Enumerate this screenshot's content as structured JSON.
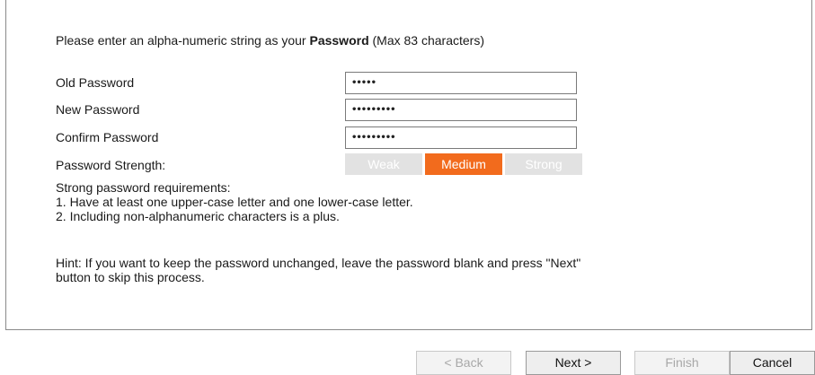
{
  "intro": {
    "prefix": "Please enter an alpha-numeric string as your ",
    "bold": "Password",
    "suffix": " (Max 83 characters)"
  },
  "fields": [
    {
      "label": "Old Password",
      "value": "•••••"
    },
    {
      "label": "New Password",
      "value": "•••••••••"
    },
    {
      "label": "Confirm Password",
      "value": "•••••••••"
    }
  ],
  "strength": {
    "label": "Password Strength:",
    "levels": [
      "Weak",
      "Medium",
      "Strong"
    ],
    "active": "Medium",
    "active_color": "#f26b1d",
    "inactive_color": "#e2e2e2"
  },
  "requirements": {
    "title": "Strong password requirements:",
    "items": [
      "1. Have at least one upper-case letter and one lower-case letter.",
      "2. Including non-alphanumeric characters is a plus."
    ]
  },
  "hint": {
    "line1": "Hint: If you want to keep the password unchanged, leave the password blank and press \"Next\"",
    "line2": "button to skip this process."
  },
  "buttons": {
    "back": "< Back",
    "next": "Next >",
    "finish": "Finish",
    "cancel": "Cancel"
  }
}
